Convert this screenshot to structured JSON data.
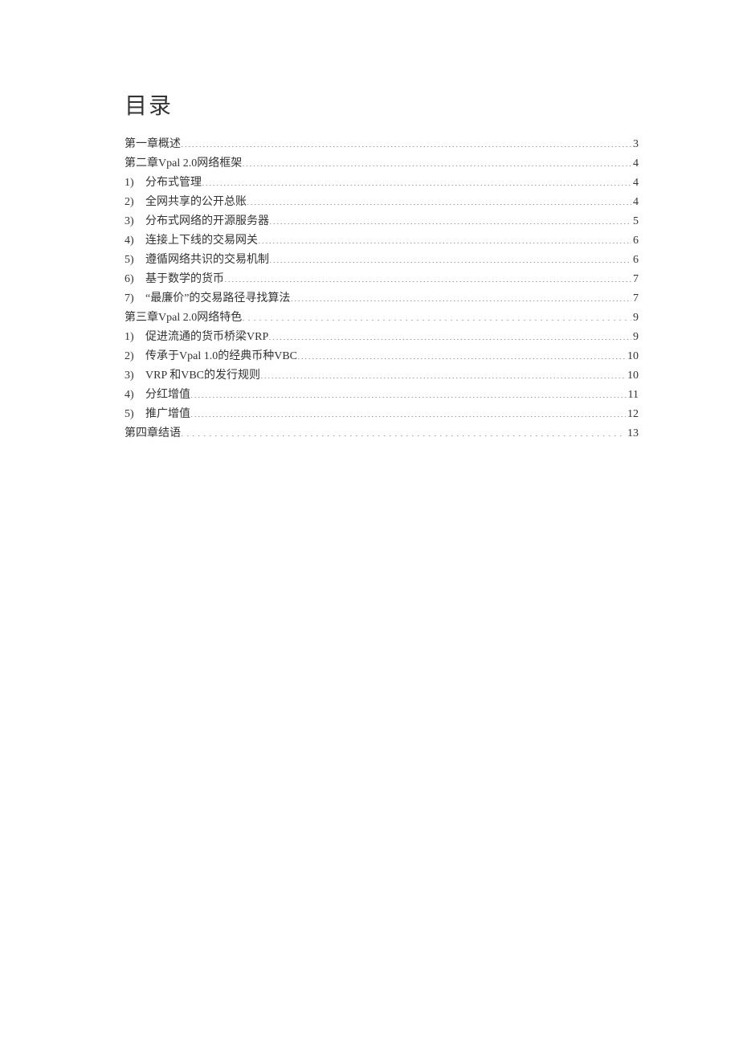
{
  "title": "目录",
  "entries": [
    {
      "marker": "",
      "label": "第一章概述",
      "page": "3",
      "leader": "dots",
      "noMarker": true
    },
    {
      "marker": "",
      "label": "第二章Vpal 2.0网络框架",
      "page": "4",
      "leader": "dots",
      "noMarker": true
    },
    {
      "marker": "1)",
      "label": "分布式管理",
      "page": "4",
      "leader": "dots",
      "noMarker": false
    },
    {
      "marker": "2)",
      "label": "全网共享的公开总账",
      "page": "4",
      "leader": "dots",
      "noMarker": false
    },
    {
      "marker": "3)",
      "label": "分布式网络的开源服务器",
      "page": "5",
      "leader": "dots",
      "noMarker": false
    },
    {
      "marker": "4)",
      "label": "连接上下线的交易网关",
      "page": "6",
      "leader": "dots",
      "noMarker": false
    },
    {
      "marker": "5)",
      "label": "遵循网络共识的交易机制",
      "page": "6",
      "leader": "dots",
      "noMarker": false
    },
    {
      "marker": "6)",
      "label": "基于数学的货币",
      "page": "7",
      "leader": "dots",
      "noMarker": false
    },
    {
      "marker": "7)",
      "label": "“最廉价”的交易路径寻找算法",
      "page": "7",
      "leader": "dots",
      "noMarker": false
    },
    {
      "marker": "",
      "label": "第三章Vpal 2.0网络特色",
      "page": "9",
      "leader": "wide-dots",
      "noMarker": true
    },
    {
      "marker": "1)",
      "label": "促进流通的货币桥梁VRP",
      "page": "9",
      "leader": "dots",
      "noMarker": false
    },
    {
      "marker": "2)",
      "label": "传承于Vpal 1.0的经典币种VBC",
      "page": "10",
      "leader": "dots",
      "noMarker": false
    },
    {
      "marker": "3)",
      "label": "VRP 和VBC的发行规则",
      "page": "10",
      "leader": "dots",
      "noMarker": false
    },
    {
      "marker": "4)",
      "label": "分红增值",
      "page": "11",
      "leader": "dots",
      "noMarker": false
    },
    {
      "marker": "5)",
      "label": "推广增值",
      "page": "12",
      "leader": "dots",
      "noMarker": false
    },
    {
      "marker": "",
      "label": "第四章结语",
      "page": "13",
      "leader": "wide-dots",
      "noMarker": true
    }
  ]
}
